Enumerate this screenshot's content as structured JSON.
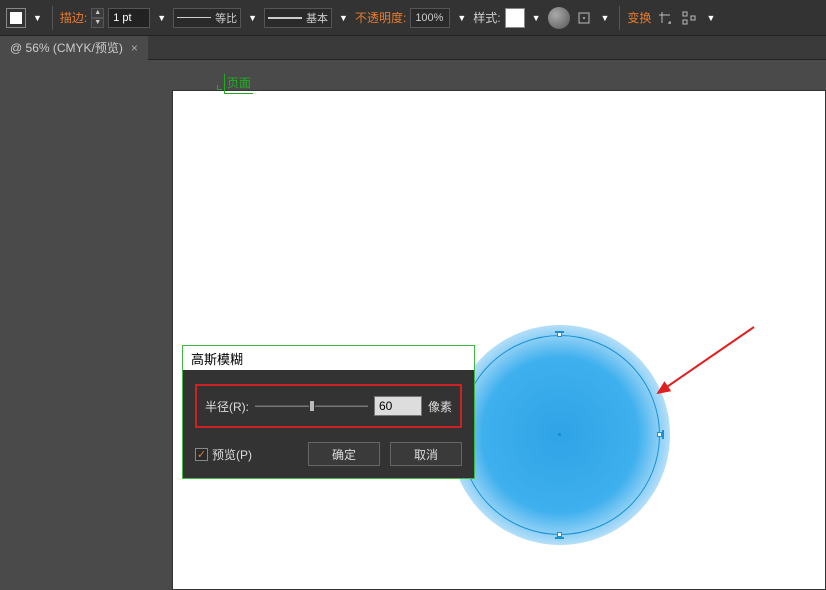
{
  "toolbar": {
    "stroke_label": "描边:",
    "stroke_width": "1 pt",
    "dash_style": "等比",
    "brush_style": "基本",
    "opacity_label": "不透明度:",
    "opacity_value": "100%",
    "style_label": "样式:",
    "transform_label": "变换"
  },
  "tab": {
    "title": "@ 56% (CMYK/预览)",
    "close": "×"
  },
  "page_label": "页面",
  "dialog": {
    "title": "高斯模糊",
    "radius_label": "半径(R):",
    "radius_value": "60",
    "radius_unit": "像素",
    "preview_label": "预览(P)",
    "ok_label": "确定",
    "cancel_label": "取消"
  },
  "colors": {
    "accent": "#e87b2e",
    "circle": "#2ea3e6",
    "highlight_border": "#c22222"
  }
}
